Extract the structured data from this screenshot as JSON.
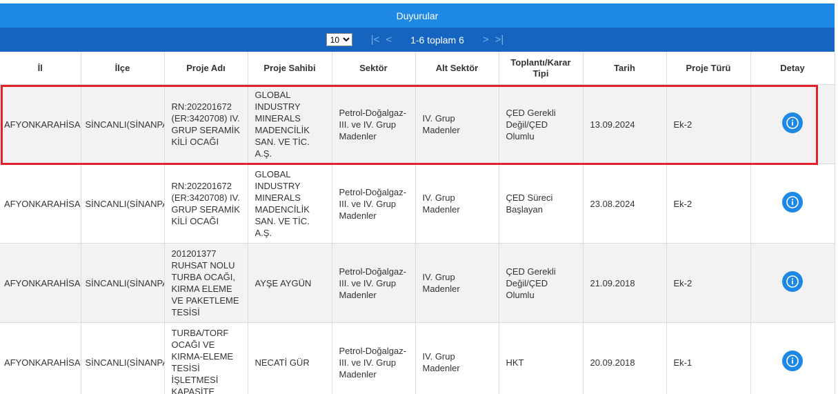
{
  "header": {
    "title": "Duyurular"
  },
  "pager": {
    "page_size_options": [
      "10"
    ],
    "page_size": "10",
    "info": "1-6 toplam 6",
    "first_icon": "first-page-icon",
    "prev_icon": "prev-page-icon",
    "next_icon": "next-page-icon",
    "last_icon": "last-page-icon"
  },
  "table": {
    "columns": [
      "İl",
      "İlçe",
      "Proje Adı",
      "Proje Sahibi",
      "Sektör",
      "Alt Sektör",
      "Toplantı/Karar Tipi",
      "Tarih",
      "Proje Türü",
      "Detay"
    ],
    "rows": [
      {
        "il": "AFYONKARAHİSAR",
        "ilce": "SİNCANLI(SİNANPAŞA)",
        "proje_adi": "RN:202201672 (ER:3420708) IV. GRUP SERAMİK KİLİ OCAĞI",
        "proje_sahibi": "GLOBAL INDUSTRY MINERALS MADENCİLİK SAN. VE TİC. A.Ş.",
        "sektor": "Petrol-Doğalgaz-III. ve IV. Grup Madenler",
        "alt_sektor": "IV. Grup Madenler",
        "karar_tipi": "ÇED Gerekli Değil/ÇED Olumlu",
        "tarih": "13.09.2024",
        "proje_turu": "Ek-2"
      },
      {
        "il": "AFYONKARAHİSAR",
        "ilce": "SİNCANLI(SİNANPAŞA)",
        "proje_adi": "RN:202201672 (ER:3420708) IV. GRUP SERAMİK KİLİ OCAĞI",
        "proje_sahibi": "GLOBAL INDUSTRY MINERALS MADENCİLİK SAN. VE TİC. A.Ş.",
        "sektor": "Petrol-Doğalgaz-III. ve IV. Grup Madenler",
        "alt_sektor": "IV. Grup Madenler",
        "karar_tipi": "ÇED Süreci Başlayan",
        "tarih": "23.08.2024",
        "proje_turu": "Ek-2"
      },
      {
        "il": "AFYONKARAHİSAR",
        "ilce": "SİNCANLI(SİNANPAŞA)",
        "proje_adi": "201201377 RUHSAT NOLU TURBA OCAĞI, KIRMA ELEME VE PAKETLEME TESİSİ",
        "proje_sahibi": "AYŞE AYGÜN",
        "sektor": "Petrol-Doğalgaz-III. ve IV. Grup Madenler",
        "alt_sektor": "IV. Grup Madenler",
        "karar_tipi": "ÇED Gerekli Değil/ÇED Olumlu",
        "tarih": "21.09.2018",
        "proje_turu": "Ek-2"
      },
      {
        "il": "AFYONKARAHİSAR",
        "ilce": "SİNCANLI(SİNANPAŞA)",
        "proje_adi": "TURBA/TORF OCAĞI VE KIRMA-ELEME TESİSİ İŞLETMESİ KAPASİTE",
        "proje_sahibi": "NECATİ GÜR",
        "sektor": "Petrol-Doğalgaz-III. ve IV. Grup Madenler",
        "alt_sektor": "IV. Grup Madenler",
        "karar_tipi": "HKT",
        "tarih": "20.09.2018",
        "proje_turu": "Ek-1"
      }
    ]
  },
  "icons": {
    "detail": "info-icon"
  },
  "colors": {
    "header_bg": "#1e88e5",
    "pager_bg": "#1565c0",
    "highlight": "#e4202b",
    "info_button": "#1e88e5"
  }
}
